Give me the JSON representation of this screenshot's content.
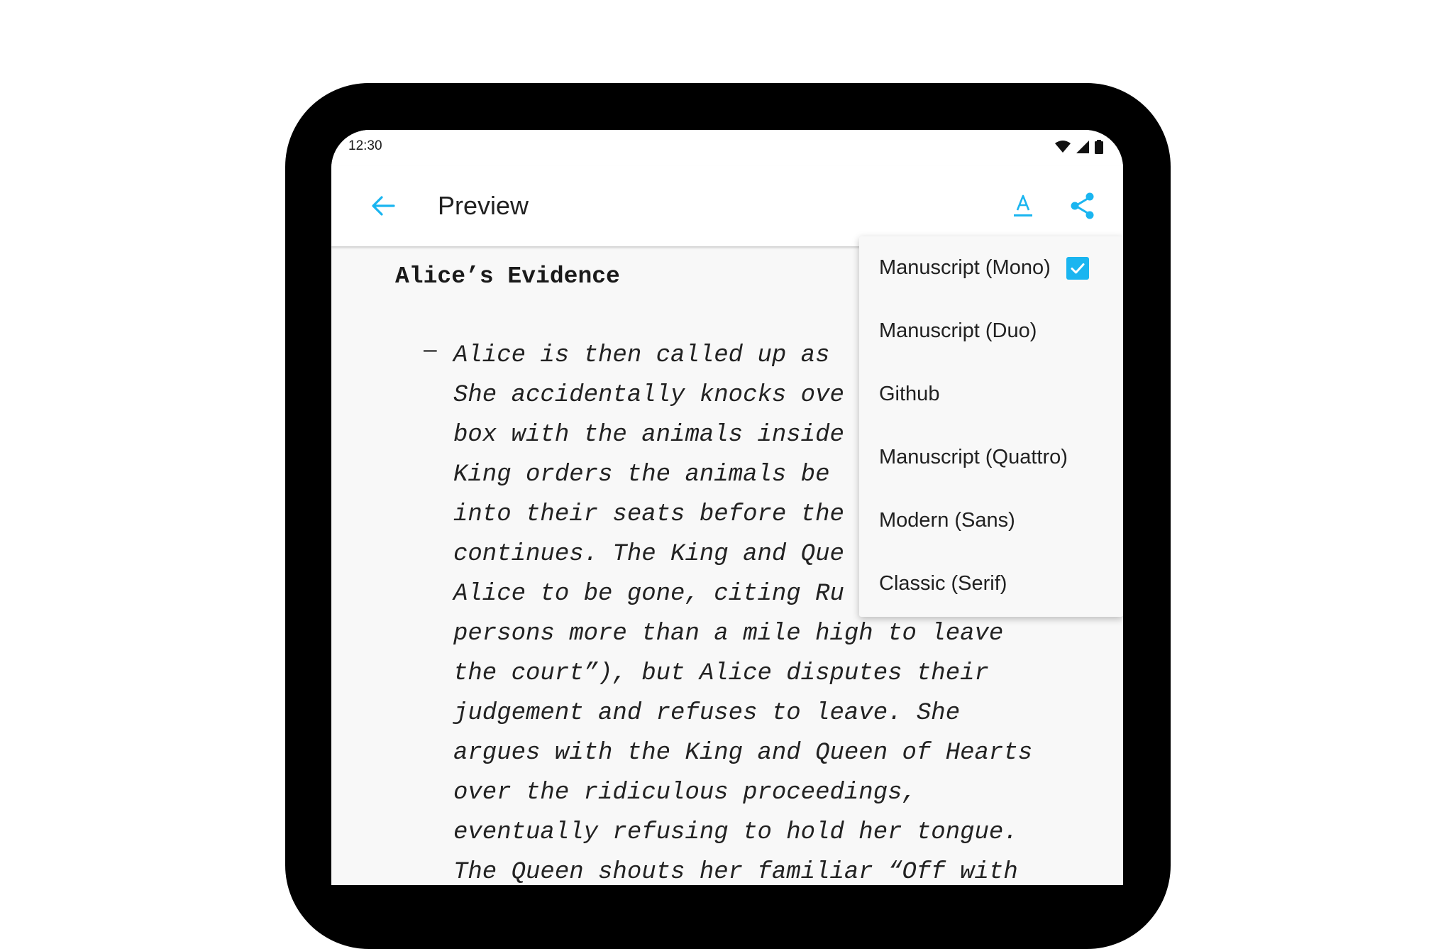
{
  "status_bar": {
    "time": "12:30"
  },
  "app_bar": {
    "title": "Preview",
    "back_icon": "arrow-left-icon",
    "font_icon": "font-style-icon",
    "share_icon": "share-icon"
  },
  "colors": {
    "accent": "#1ab5f0"
  },
  "document": {
    "heading": "Alice’s Evidence",
    "bullet": "–",
    "lines": [
      "Alice is then called up as",
      "She accidentally knocks ove",
      "box with the animals inside",
      "King orders the animals be ",
      "into their seats before the",
      "continues. The King and Que",
      "Alice to be gone, citing Ru",
      "persons more than a mile high to leave",
      "the court”), but Alice disputes their",
      "judgement and refuses to leave. She",
      "argues with the King and Queen of Hearts",
      "over the ridiculous proceedings,",
      "eventually refusing to hold her tongue.",
      "The Queen shouts her familiar “Off with"
    ]
  },
  "font_menu": {
    "items": [
      {
        "label": "Manuscript (Mono)",
        "checked": true
      },
      {
        "label": "Manuscript (Duo)",
        "checked": false
      },
      {
        "label": "Github",
        "checked": false
      },
      {
        "label": "Manuscript (Quattro)",
        "checked": false
      },
      {
        "label": "Modern (Sans)",
        "checked": false
      },
      {
        "label": "Classic (Serif)",
        "checked": false
      }
    ]
  }
}
